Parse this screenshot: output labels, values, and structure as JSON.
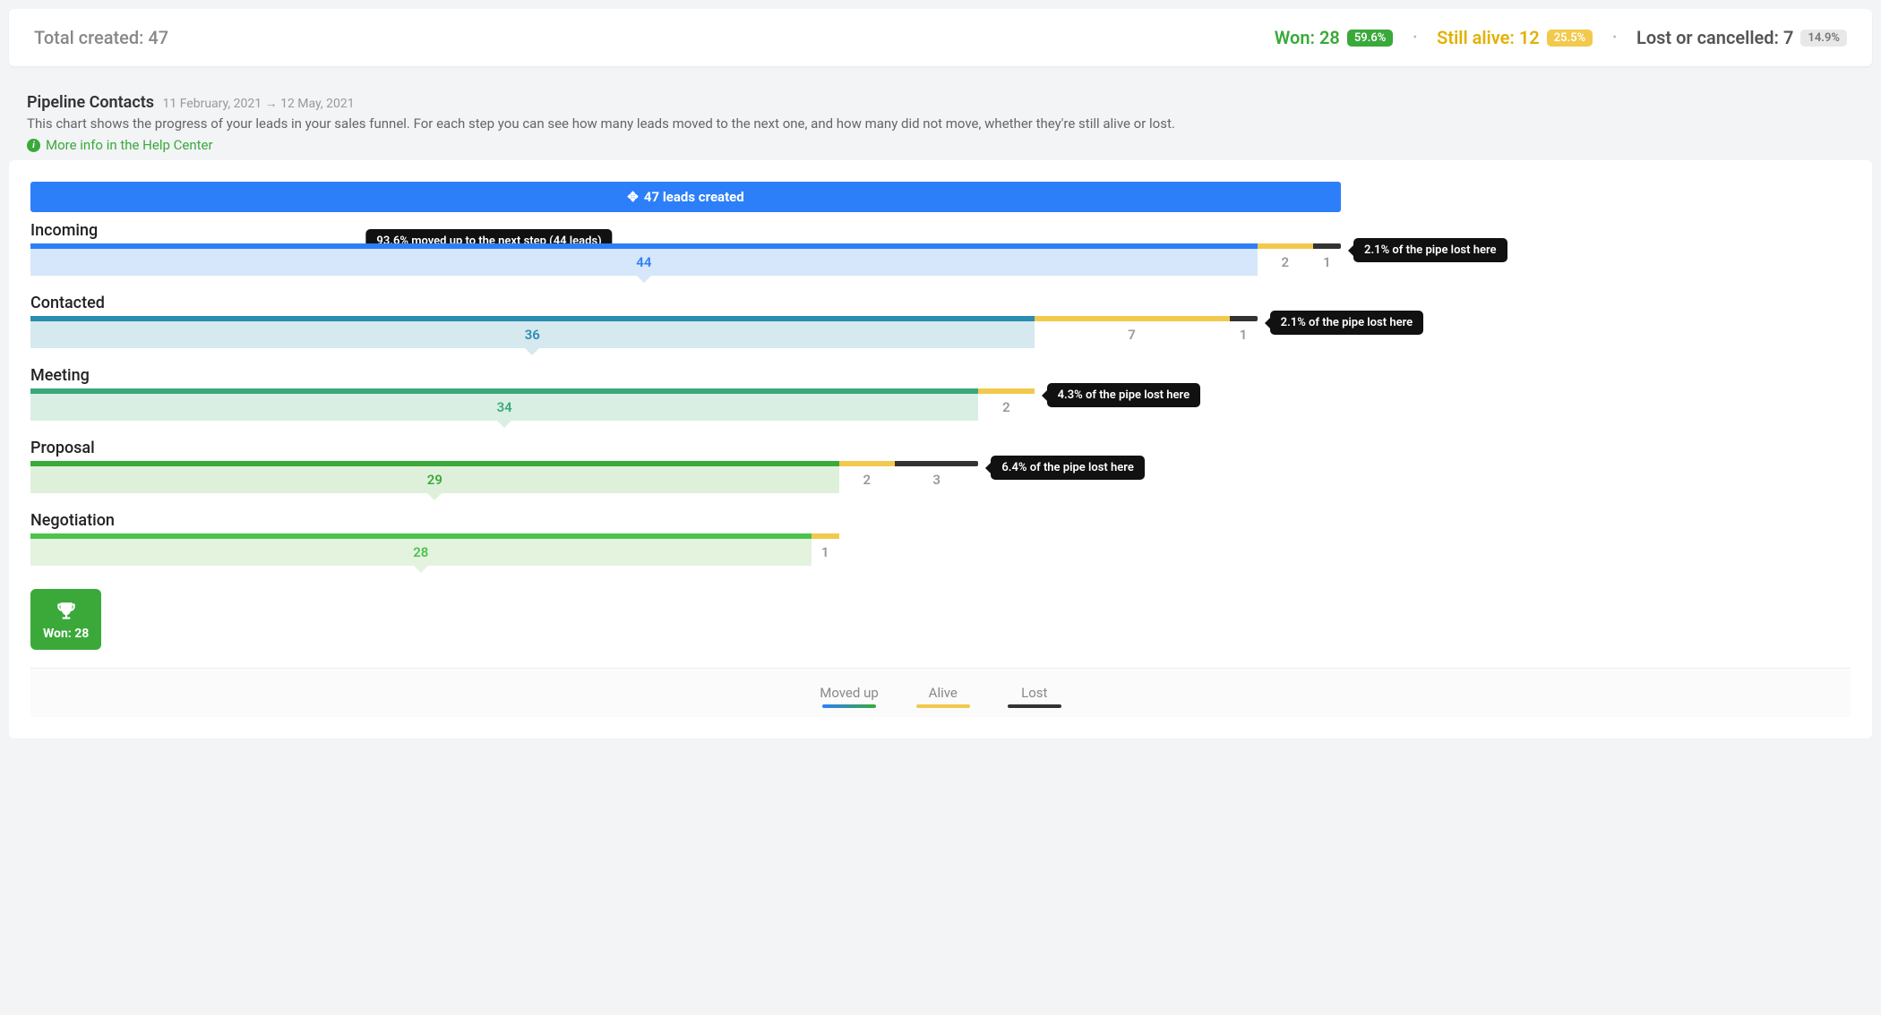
{
  "summary": {
    "total_label": "Total created:",
    "total_value": "47",
    "won_label": "Won:",
    "won_value": "28",
    "won_pct": "59.6%",
    "alive_label": "Still alive:",
    "alive_value": "12",
    "alive_pct": "25.5%",
    "lost_label": "Lost or cancelled:",
    "lost_value": "7",
    "lost_pct": "14.9%"
  },
  "desc": {
    "title": "Pipeline Contacts",
    "date_from": "11 February, 2021",
    "date_to": "12 May, 2021",
    "text": "This chart shows the progress of your leads in your sales funnel. For each step you can see how many leads moved to the next one, and how many did not move, whether they're still alive or lost.",
    "help_link": "More info in the Help Center"
  },
  "funnel": {
    "header": "47 leads created",
    "total": 47,
    "top_tooltip": "93.6% moved up to the next step (44 leads)",
    "stages": [
      {
        "name": "Incoming",
        "moved": 44,
        "alive": 2,
        "lost": 1,
        "tooltip": "2.1% of the pipe lost here",
        "color_top": "#2d7ff9",
        "color_body": "#d6e6fb",
        "color_text": "#2d7ff9"
      },
      {
        "name": "Contacted",
        "moved": 36,
        "alive": 7,
        "lost": 1,
        "tooltip": "2.1% of the pipe lost here",
        "color_top": "#2b8db0",
        "color_body": "#d5e9ef",
        "color_text": "#2b8db0"
      },
      {
        "name": "Meeting",
        "moved": 34,
        "alive": 2,
        "lost": 0,
        "tooltip": "4.3% of the pipe lost here",
        "color_top": "#3ba87a",
        "color_body": "#d9efe4",
        "color_text": "#3ba87a"
      },
      {
        "name": "Proposal",
        "moved": 29,
        "alive": 2,
        "lost": 3,
        "tooltip": "6.4% of the pipe lost here",
        "color_top": "#3aa93a",
        "color_body": "#dff0da",
        "color_text": "#3aa93a"
      },
      {
        "name": "Negotiation",
        "moved": 28,
        "alive": 1,
        "lost": 0,
        "tooltip": "",
        "color_top": "#4dc24d",
        "color_body": "#e3f3de",
        "color_text": "#4dc24d"
      }
    ],
    "won_box": "Won: 28"
  },
  "legend": {
    "moved": "Moved up",
    "alive": "Alive",
    "lost": "Lost"
  },
  "chart_data": {
    "type": "bar",
    "title": "Pipeline Contacts",
    "date_range": [
      "11 February, 2021",
      "12 May, 2021"
    ],
    "total_created": 47,
    "won": 28,
    "still_alive": 12,
    "lost_or_cancelled": 7,
    "won_pct": 59.6,
    "still_alive_pct": 25.5,
    "lost_or_cancelled_pct": 14.9,
    "categories": [
      "Incoming",
      "Contacted",
      "Meeting",
      "Proposal",
      "Negotiation"
    ],
    "series": [
      {
        "name": "Moved up",
        "values": [
          44,
          36,
          34,
          29,
          28
        ]
      },
      {
        "name": "Alive",
        "values": [
          2,
          7,
          2,
          2,
          1
        ]
      },
      {
        "name": "Lost",
        "values": [
          1,
          1,
          0,
          3,
          0
        ]
      }
    ],
    "annotations": {
      "top": "93.6% moved up to the next step (44 leads)",
      "lost_pct_of_pipe": [
        2.1,
        2.1,
        4.3,
        6.4,
        null
      ]
    }
  }
}
